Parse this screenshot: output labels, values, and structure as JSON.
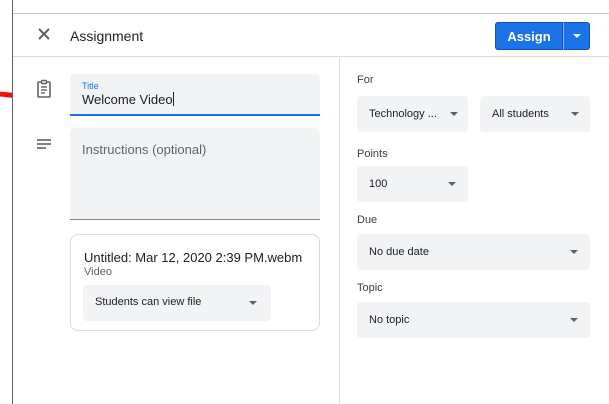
{
  "header": {
    "close_icon": "close-icon",
    "title": "Assignment",
    "assign_label": "Assign",
    "assign_menu_icon": "caret-down-icon",
    "brand_color": "#1a73e8"
  },
  "sidebar_icons": [
    "assignment-icon",
    "notes-icon"
  ],
  "title_field": {
    "label": "Title",
    "value": "Welcome Video"
  },
  "instructions_field": {
    "placeholder": "Instructions (optional)"
  },
  "attachment": {
    "name": "Untitled: Mar 12, 2020 2:39 PM.webm",
    "type": "Video",
    "permission": "Students can view file"
  },
  "right_panel": {
    "for_label": "For",
    "class_value": "Technology ...",
    "students_value": "All students",
    "points_label": "Points",
    "points_value": "100",
    "due_label": "Due",
    "due_value": "No due date",
    "topic_label": "Topic",
    "topic_value": "No topic"
  },
  "annotation": {
    "arrow_color": "#e8140b"
  }
}
